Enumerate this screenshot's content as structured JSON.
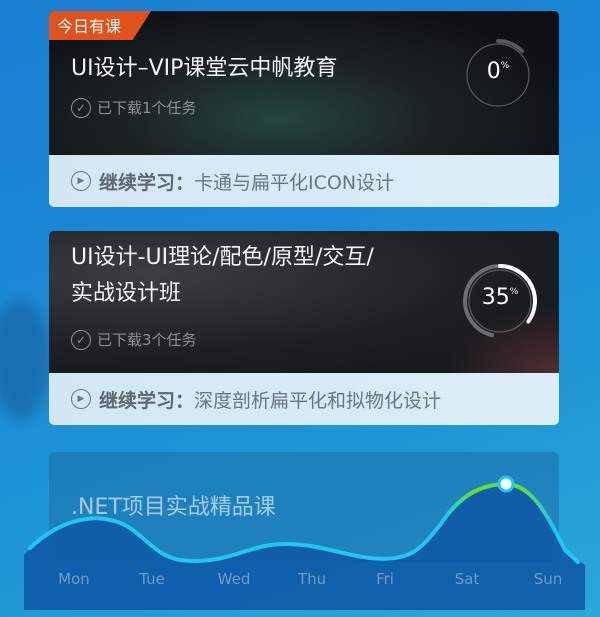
{
  "courses": [
    {
      "badge": "今日有课",
      "title": "UI设计–VIP课堂云中帆教育",
      "downloaded": "已下载1个任务",
      "progress": 0,
      "progress_label": "0",
      "percent_sign": "%",
      "continue_label": "继续学习：",
      "continue_lesson": "卡通与扁平化ICON设计"
    },
    {
      "title_line1": "UI设计-UI理论/配色/原型/交互/",
      "title_line2": "实战设计班",
      "downloaded": "已下载3个任务",
      "progress": 35,
      "progress_label": "35",
      "percent_sign": "%",
      "continue_label": "继续学习：",
      "continue_lesson": "深度剖析扁平化和拟物化设计"
    },
    {
      "title": ".NET项目实战精品课"
    }
  ],
  "week_chart": {
    "days": [
      "Mon",
      "Tue",
      "Wed",
      "Thu",
      "Fri",
      "Sat",
      "Sun"
    ],
    "highlight_day": "Sat"
  },
  "colors": {
    "badge": "#e0521c",
    "wave_line": "#1ec8f0",
    "wave_peak": "#5ee03a",
    "background": "#1a7fd0"
  }
}
